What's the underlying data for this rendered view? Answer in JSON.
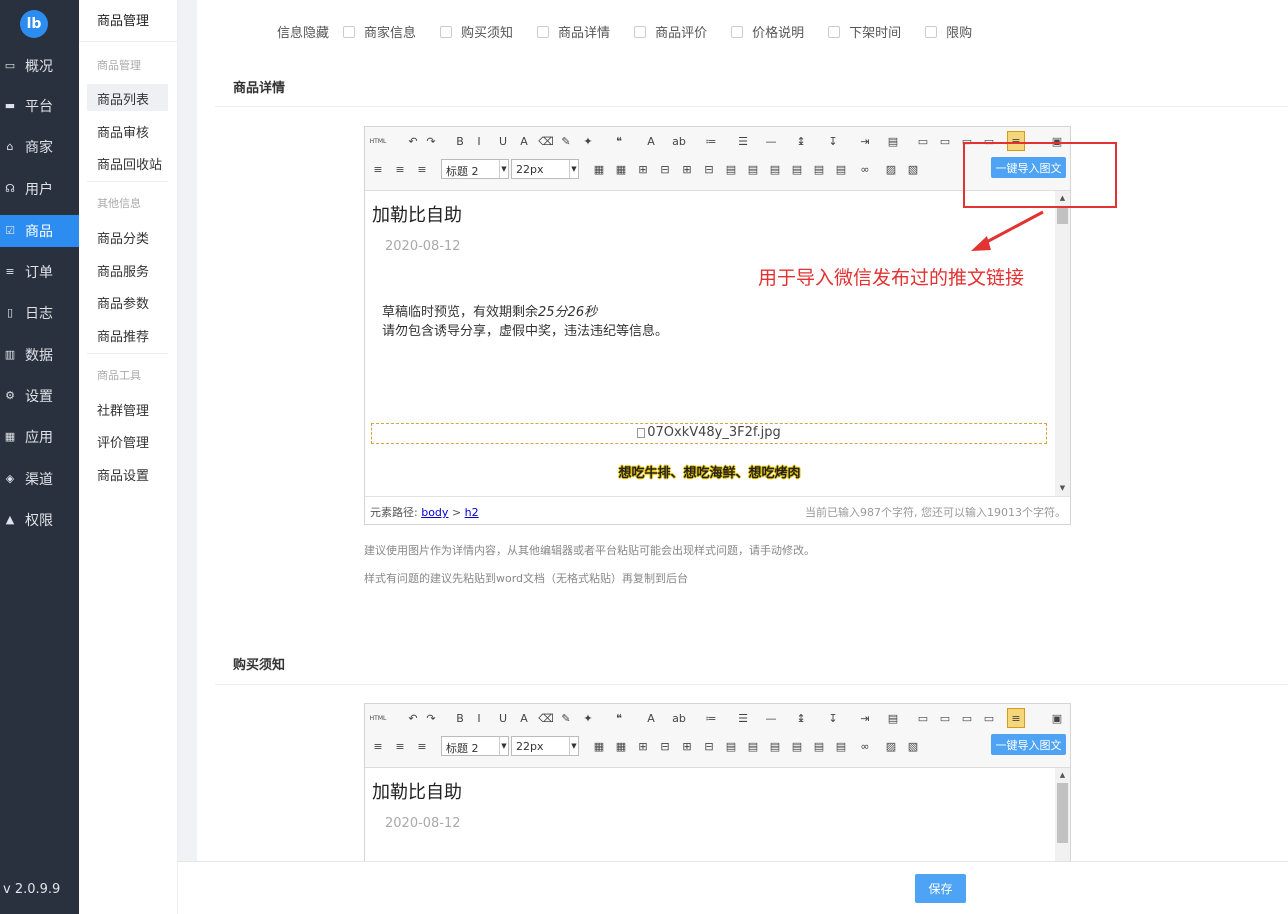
{
  "app": {
    "logo": "lb",
    "version": "v 2.0.9.9"
  },
  "nav": [
    {
      "label": "概况",
      "icon": "dashboard-icon",
      "glyph": "▭"
    },
    {
      "label": "平台",
      "icon": "monitor-icon",
      "glyph": "▬"
    },
    {
      "label": "商家",
      "icon": "store-icon",
      "glyph": "⌂"
    },
    {
      "label": "用户",
      "icon": "user-icon",
      "glyph": "☊"
    },
    {
      "label": "商品",
      "icon": "goods-icon",
      "glyph": "☑"
    },
    {
      "label": "订单",
      "icon": "order-icon",
      "glyph": "≡"
    },
    {
      "label": "日志",
      "icon": "log-icon",
      "glyph": "▯"
    },
    {
      "label": "数据",
      "icon": "bar-chart-icon",
      "glyph": "▥"
    },
    {
      "label": "设置",
      "icon": "gear-icon",
      "glyph": "⚙"
    },
    {
      "label": "应用",
      "icon": "apps-grid-icon",
      "glyph": "▦"
    },
    {
      "label": "渠道",
      "icon": "cube-icon",
      "glyph": "◈"
    },
    {
      "label": "权限",
      "icon": "lock-icon",
      "glyph": "▲"
    }
  ],
  "subnav": {
    "title": "商品管理",
    "group1": "商品管理",
    "items1": [
      "商品列表",
      "商品审核",
      "商品回收站"
    ],
    "group2": "其他信息",
    "items2": [
      "商品分类",
      "商品服务",
      "商品参数",
      "商品推荐"
    ],
    "group3": "商品工具",
    "items3": [
      "社群管理",
      "评价管理",
      "商品设置"
    ]
  },
  "hide_row": {
    "label": "信息隐藏",
    "options": [
      "商家信息",
      "购买须知",
      "商品详情",
      "商品评价",
      "价格说明",
      "下架时间",
      "限购"
    ]
  },
  "sections": {
    "detail_title": "商品详情",
    "notice_title": "购买须知"
  },
  "editor": {
    "style_select": "标题 2",
    "size_select": "22px",
    "import_label": "一键导入图文",
    "html_label": "HTML",
    "heading": "加勒比自助",
    "date": "2020-08-12",
    "line1": "草稿临时预览，有效期剩余",
    "line1_em": "25分26秒",
    "line2": "请勿包含诱导分享，虚假中奖，违法违纪等信息。",
    "image_alt": "07OxkV48y_3F2f.jpg",
    "caption": "想吃牛排、想吃海鲜、想吃烤肉",
    "path_label": "元素路径:",
    "path_body": "body",
    "path_sep": ">",
    "path_h2": "h2",
    "char_count": "当前已输入987个字符, 您还可以输入19013个字符。"
  },
  "hints": [
    "建议使用图片作为详情内容，从其他编辑器或者平台粘贴可能会出现样式问题，请手动修改。",
    "样式有问题的建议先粘贴到word文档（无格式粘贴）再复制到后台"
  ],
  "annotation": "用于导入微信发布过的推文链接",
  "footer": {
    "save_label": "保存"
  },
  "colors": {
    "sidebar": "#28313d",
    "accent": "#2d8cf0",
    "button": "#4ea3f4",
    "annotation": "#e23232"
  }
}
